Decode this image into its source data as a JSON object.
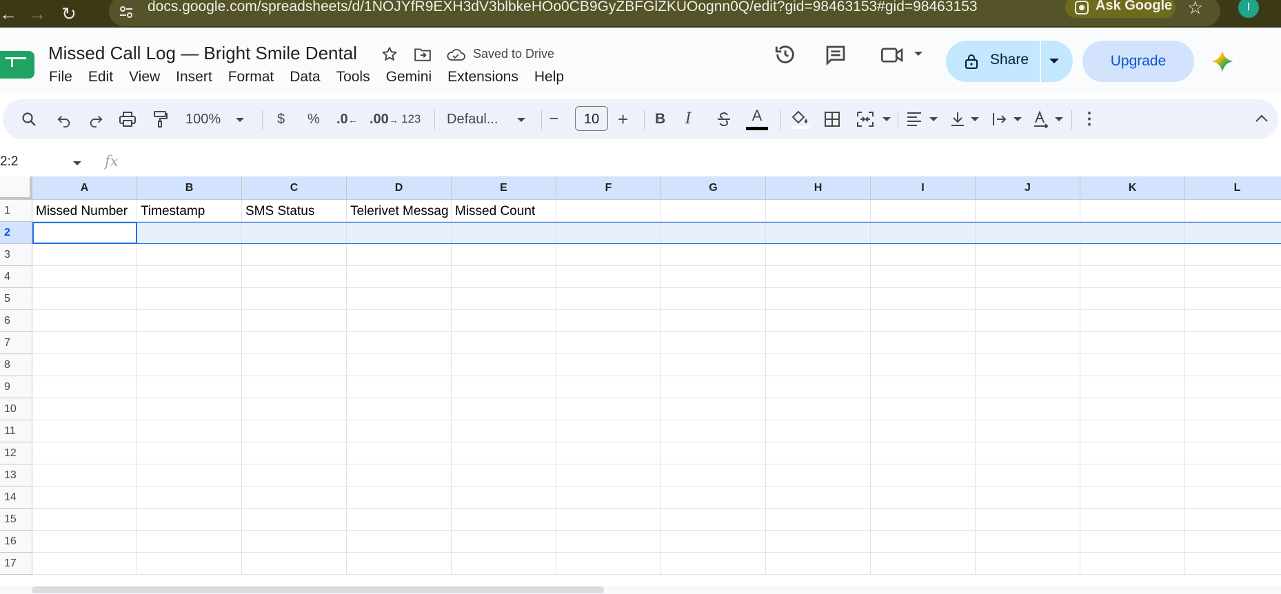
{
  "browser": {
    "url": "docs.google.com/spreadsheets/d/1NOJYfR9EXH3dV3blbkeHOo0CB9GyZBFGlZKUOognn0Q/edit?gid=98463153#gid=98463153",
    "ask_label": "Ask Google",
    "avatar_letter": "I",
    "back_glyph": "←",
    "forward_glyph": "→",
    "reload_glyph": "↻",
    "star_glyph": "☆"
  },
  "doc": {
    "title": "Missed Call Log — Bright Smile Dental",
    "saved_status": "Saved to Drive",
    "share_label": "Share",
    "upgrade_label": "Upgrade"
  },
  "menu": [
    "File",
    "Edit",
    "View",
    "Insert",
    "Format",
    "Data",
    "Tools",
    "Gemini",
    "Extensions",
    "Help"
  ],
  "toolbar": {
    "zoom": "100%",
    "currency": "$",
    "percent": "%",
    "dec_decrease": ".0",
    "dec_increase": ".00",
    "number_format": "123",
    "font": "Defaul...",
    "minus": "−",
    "font_size": "10",
    "plus": "+",
    "bold": "B",
    "italic": "I",
    "text_color_letter": "A",
    "more": "⋮",
    "collapse": "^"
  },
  "formula_bar": {
    "name_box": "2:2",
    "fx": "fx",
    "value": ""
  },
  "sheet": {
    "columns": [
      "A",
      "B",
      "C",
      "D",
      "E",
      "F",
      "G",
      "H",
      "I",
      "J",
      "K",
      "L"
    ],
    "rows": [
      "1",
      "2",
      "3",
      "4",
      "5",
      "6",
      "7",
      "8",
      "9",
      "10",
      "11",
      "12",
      "13",
      "14",
      "15",
      "16",
      "17"
    ],
    "header_row": [
      "Missed Number",
      "Timestamp",
      "SMS Status",
      "Telerivet Messag",
      "Missed Count",
      "",
      "",
      "",
      "",
      "",
      "",
      ""
    ],
    "selected_row": "2",
    "selected_cell": "A2"
  },
  "colors": {
    "browser_bg": "#3c3a16",
    "header_selected": "#d3e3fd",
    "selection_blue": "#1a73e8",
    "share_bg": "#c2e7ff",
    "sheets_green": "#1fa463"
  }
}
